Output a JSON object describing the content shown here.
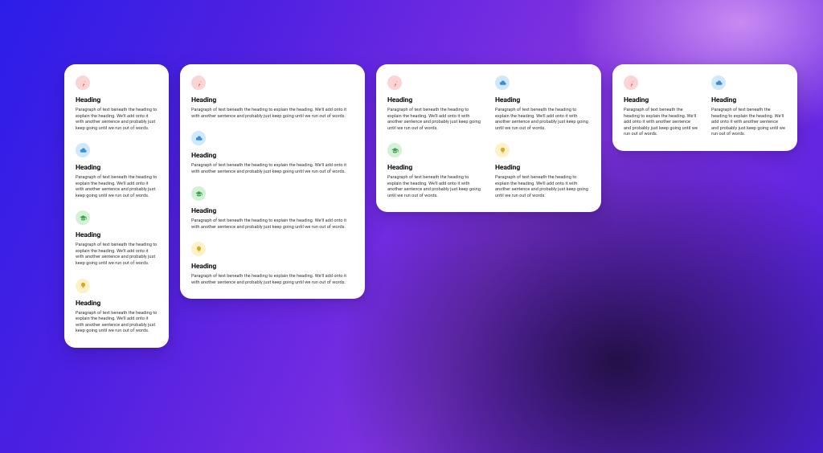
{
  "heading": "Heading",
  "para_long": "Paragraph of text beneath the heading to explain the heading. We'll add onto it with another sentence and probably just keep going until we run out of words.",
  "para_short": "Paragraph of text beneath the heading to explain the heading. We'll add onto it with another sentence and probably just keep going until we run out of words.",
  "icons": {
    "pin": "pin-icon",
    "cloud": "cloud-icon",
    "cap": "graduation-cap-icon",
    "bulb": "lightbulb-icon"
  },
  "colors": {
    "pin_bg": "#fbd5d5",
    "cloud_bg": "#cfe8fb",
    "cap_bg": "#d3f2d3",
    "bulb_bg": "#fdf1c7"
  }
}
